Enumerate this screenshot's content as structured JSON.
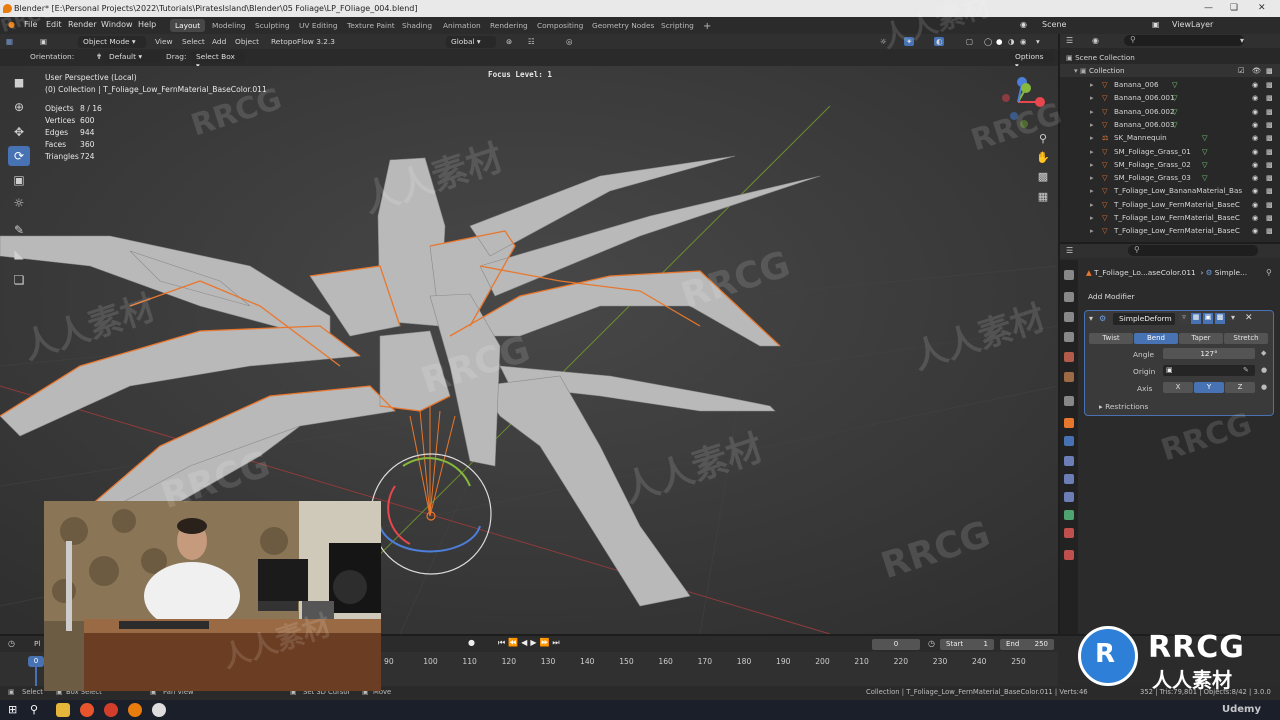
{
  "window": {
    "title": "Blender* [E:\\Personal Projects\\2022\\Tutorials\\PiratesIsland\\Blender\\05 Foliage\\LP_FOliage_004.blend]"
  },
  "menu": [
    "File",
    "Edit",
    "Render",
    "Window",
    "Help"
  ],
  "workspaces": [
    "Layout",
    "Modeling",
    "Sculpting",
    "UV Editing",
    "Texture Paint",
    "Shading",
    "Animation",
    "Rendering",
    "Compositing",
    "Geometry Nodes",
    "Scripting"
  ],
  "active_workspace": "Layout",
  "scene": {
    "label": "Scene",
    "view_layer": "ViewLayer"
  },
  "viewport_header": {
    "mode": "Object Mode",
    "menus": [
      "View",
      "Select",
      "Add",
      "Object"
    ],
    "addon": "RetopoFlow 3.2.3",
    "transform": "Global",
    "orientation_label": "Orientation:",
    "orientation_value": "Default",
    "drag_label": "Drag:",
    "drag_value": "Select Box",
    "options_label": "Options"
  },
  "viewport": {
    "perspective": "User Perspective (Local)",
    "collection_info": "(0) Collection | T_Foliage_Low_FernMaterial_BaseColor.011",
    "focus_level": "Focus Level: 1",
    "stats": [
      {
        "label": "Objects",
        "value": "8 / 16"
      },
      {
        "label": "Vertices",
        "value": "600"
      },
      {
        "label": "Edges",
        "value": "944"
      },
      {
        "label": "Faces",
        "value": "360"
      },
      {
        "label": "Triangles",
        "value": "724"
      }
    ]
  },
  "outliner": {
    "root": "Scene Collection",
    "collection": "Collection",
    "items": [
      "Banana_006",
      "Banana_006.001",
      "Banana_006.002",
      "Banana_006.003",
      "SK_Mannequin",
      "SM_Foliage_Grass_01",
      "SM_Foliage_Grass_02",
      "SM_Foliage_Grass_03",
      "T_Foliage_Low_BananaMaterial_Bas",
      "T_Foliage_Low_FernMaterial_BaseC",
      "T_Foliage_Low_FernMaterial_BaseC",
      "T_Foliage_Low_FernMaterial_BaseC"
    ]
  },
  "properties": {
    "breadcrumb_object": "T_Foliage_Lo...aseColor.011",
    "breadcrumb_modifier": "Simple...",
    "add_modifier": "Add Modifier",
    "modifier_name": "SimpleDeform",
    "deform_modes": [
      "Twist",
      "Bend",
      "Taper",
      "Stretch"
    ],
    "active_mode": "Bend",
    "angle_label": "Angle",
    "angle_value": "127°",
    "origin_label": "Origin",
    "axis_label": "Axis",
    "axes": [
      "X",
      "Y",
      "Z"
    ],
    "active_axis": "Y",
    "restrictions": "Restrictions"
  },
  "timeline": {
    "playback_label": "Pl",
    "current_frame": "0",
    "start_label": "Start",
    "start_value": "1",
    "end_label": "End",
    "end_value": "250",
    "playhead_label": "0",
    "ticks": [
      "90",
      "100",
      "110",
      "120",
      "130",
      "140",
      "150",
      "160",
      "170",
      "180",
      "190",
      "200",
      "210",
      "220",
      "230",
      "240",
      "250"
    ]
  },
  "statusbar": {
    "select": "Select",
    "box_select": "Box Select",
    "pan_view": "Pan View",
    "set_3d_cursor": "Set 3D Cursor",
    "move": "Move",
    "right_info": "Collection | T_Foliage_Low_FernMaterial_BaseColor.011 | Verts:46",
    "right_info2": "352 | Tris:79,801 | Objects:8/42 | 3.0.0"
  },
  "watermarks": {
    "rrcg": "RRCG",
    "cn": "人人素材",
    "udemy": "Udemy"
  },
  "colors": {
    "accent_blue": "#4772b3",
    "selection_orange": "#e8772e",
    "viewport_bg": "#3c3c3c",
    "panel_bg": "#2b2b2b"
  }
}
